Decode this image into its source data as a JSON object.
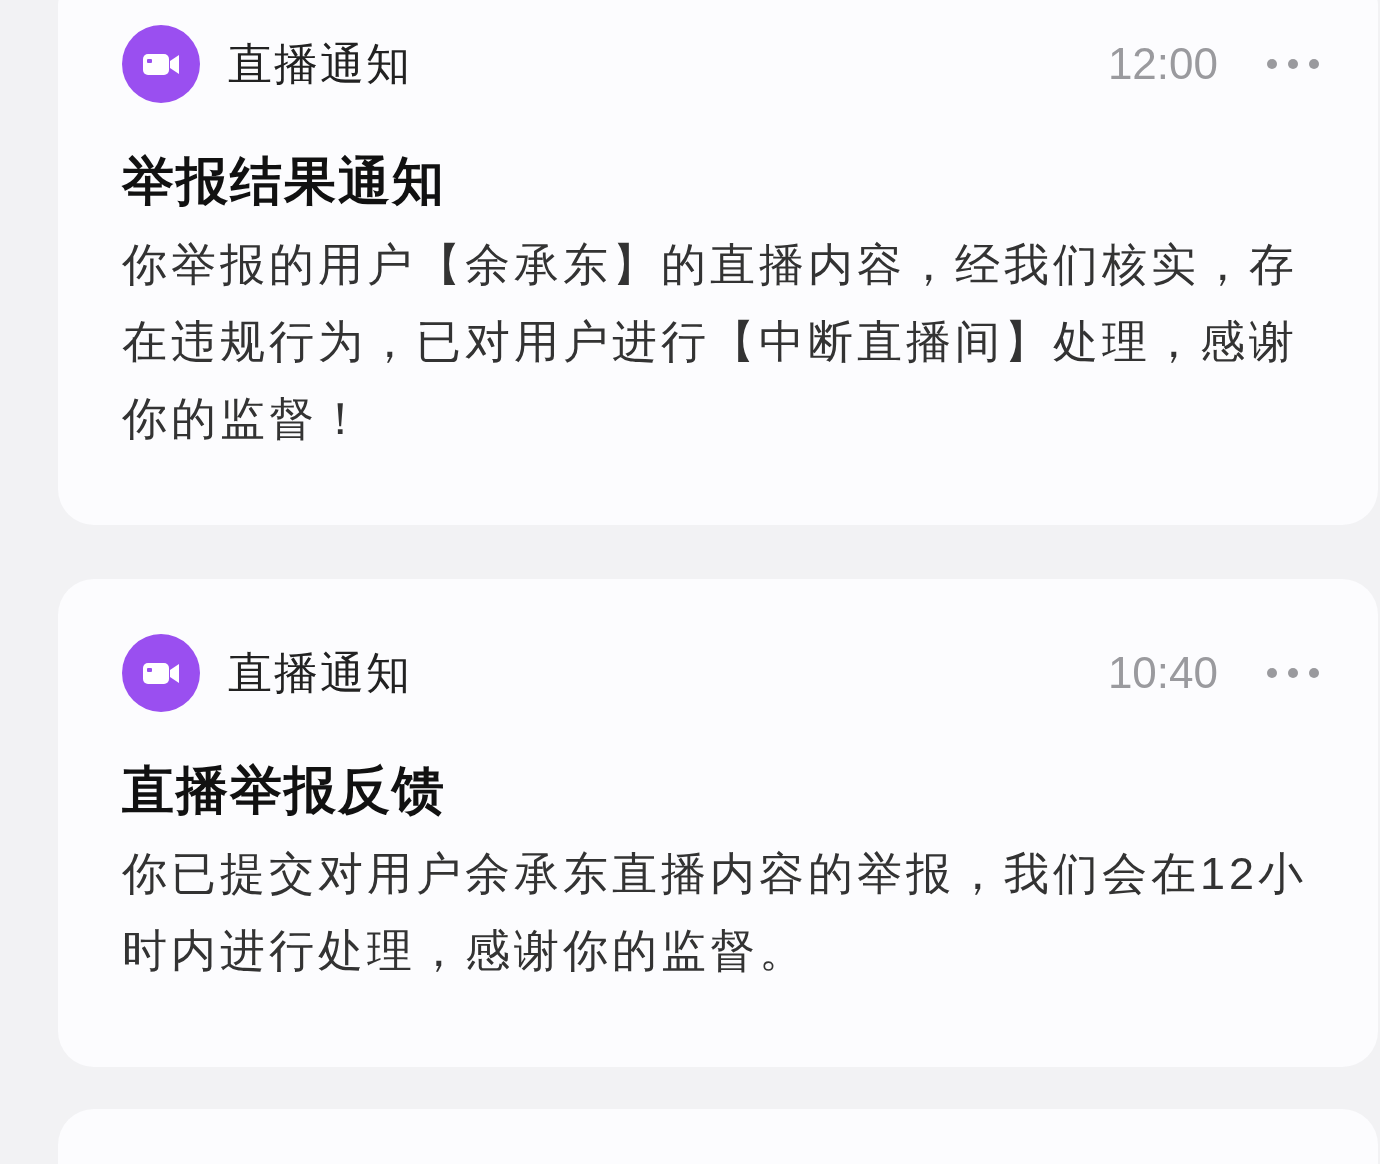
{
  "notifications": [
    {
      "app_name": "直播通知",
      "time": "12:00",
      "title": "举报结果通知",
      "body": "你举报的用户【余承东】的直播内容，经我们核实，存在违规行为，已对用户进行【中断直播间】处理，感谢你的监督！"
    },
    {
      "app_name": "直播通知",
      "time": "10:40",
      "title": "直播举报反馈",
      "body": "你已提交对用户余承东直播内容的举报，我们会在12小时内进行处理，感谢你的监督。"
    }
  ]
}
